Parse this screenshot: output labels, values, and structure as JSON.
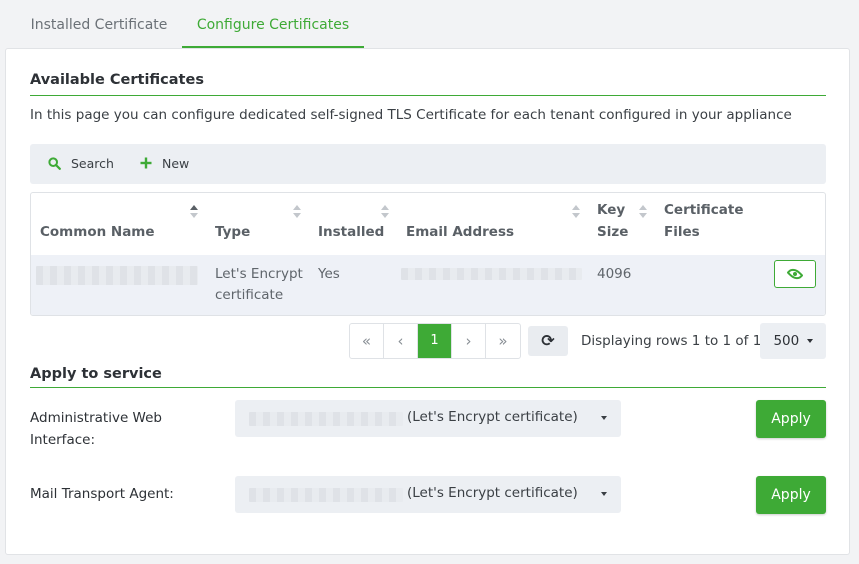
{
  "tabs": [
    {
      "label": "Installed Certificate"
    },
    {
      "label": "Configure Certificates"
    }
  ],
  "available": {
    "title": "Available Certificates",
    "description": "In this page you can configure dedicated self-signed TLS Certificate for each tenant configured in your appliance"
  },
  "toolbar": {
    "search_label": "Search",
    "new_label": "New"
  },
  "table": {
    "columns": [
      "Common Name",
      "Type",
      "Installed",
      "Email Address",
      "Key",
      "Size",
      "Certificate",
      "Files"
    ],
    "row": {
      "type_line1": "Let's Encrypt",
      "type_line2": "certificate",
      "installed": "Yes",
      "key_size": "4096"
    }
  },
  "pagination": {
    "first": "«",
    "prev": "‹",
    "current": "1",
    "next": "›",
    "last": "»",
    "refresh_icon": "⟳",
    "info": "Displaying rows 1 to 1 of 1",
    "page_size": "500"
  },
  "apply_section": {
    "title": "Apply to service",
    "services": [
      {
        "label_line1": "Administrative Web",
        "label_line2": "Interface:",
        "selected": "(Let's Encrypt certificate)",
        "button": "Apply"
      },
      {
        "label_line1": "Mail Transport Agent:",
        "selected": "(Let's Encrypt certificate)",
        "button": "Apply"
      }
    ]
  },
  "colors": {
    "accent": "#3eaa36"
  }
}
